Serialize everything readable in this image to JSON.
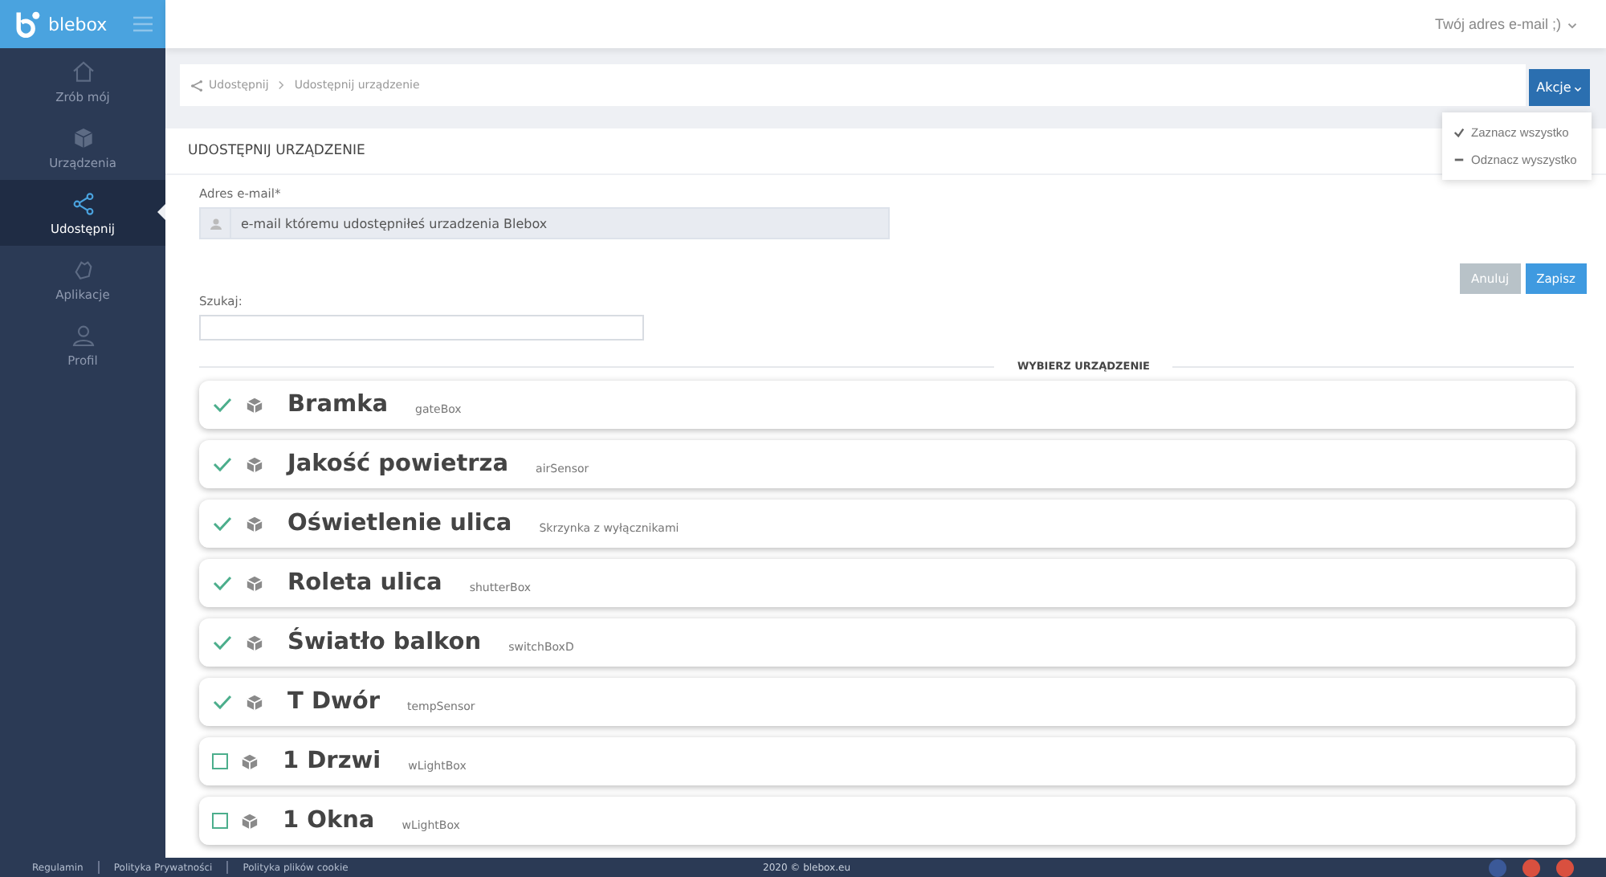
{
  "brand": "blebox",
  "user_menu": {
    "label": "Twój adres e-mail ;)"
  },
  "sidebar": {
    "items": [
      {
        "label": "Zrób mój",
        "kind": "home",
        "selected": false
      },
      {
        "label": "Urządzenia",
        "kind": "devices",
        "selected": false
      },
      {
        "label": "Udostępnij",
        "kind": "share",
        "selected": true
      },
      {
        "label": "Aplikacje",
        "kind": "apps",
        "selected": false
      },
      {
        "label": "Profil",
        "kind": "profile",
        "selected": false
      }
    ]
  },
  "breadcrumb": [
    "Udostępnij",
    "Udostępnij urządzenie"
  ],
  "actions": {
    "label": "Akcje",
    "menu": [
      {
        "label": "Zaznacz wszystko",
        "kind": "select"
      },
      {
        "label": "Odznacz wyszystko",
        "kind": "deselect"
      }
    ]
  },
  "card": {
    "title": "UDOSTĘPNIJ URZĄDZENIE",
    "email": {
      "label": "Adres e-mail*",
      "value": "e-mail któremu udostępniłeś urzadzenia Blebox"
    },
    "buttons": [
      {
        "label": "Anuluj",
        "kind": "cancel"
      },
      {
        "label": "Zapisz",
        "kind": "save"
      }
    ],
    "search": {
      "label": "Szukaj:"
    },
    "section_title": "WYBIERZ URZĄDZENIE",
    "devices": [
      {
        "name": "Bramka",
        "type": "gateBox",
        "checked": true
      },
      {
        "name": "Jakość powietrza",
        "type": "airSensor",
        "checked": true
      },
      {
        "name": "Oświetlenie ulica",
        "type": "Skrzynka z wyłącznikami",
        "checked": true
      },
      {
        "name": "Roleta ulica",
        "type": "shutterBox",
        "checked": true
      },
      {
        "name": "Światło balkon",
        "type": "switchBoxD",
        "checked": true
      },
      {
        "name": "T Dwór",
        "type": "tempSensor",
        "checked": true
      },
      {
        "name": "1 Drzwi",
        "type": "wLightBox",
        "checked": false
      },
      {
        "name": "1 Okna",
        "type": "wLightBox",
        "checked": false
      }
    ]
  },
  "footer": {
    "links": [
      "Regulamin",
      "Polityka Prywatności",
      "Polityka plików cookie"
    ],
    "copyright": "2020 © blebox.eu",
    "social": [
      {
        "color": "#3b5998"
      },
      {
        "color": "#d9503f"
      },
      {
        "color": "#d9503f"
      }
    ]
  }
}
